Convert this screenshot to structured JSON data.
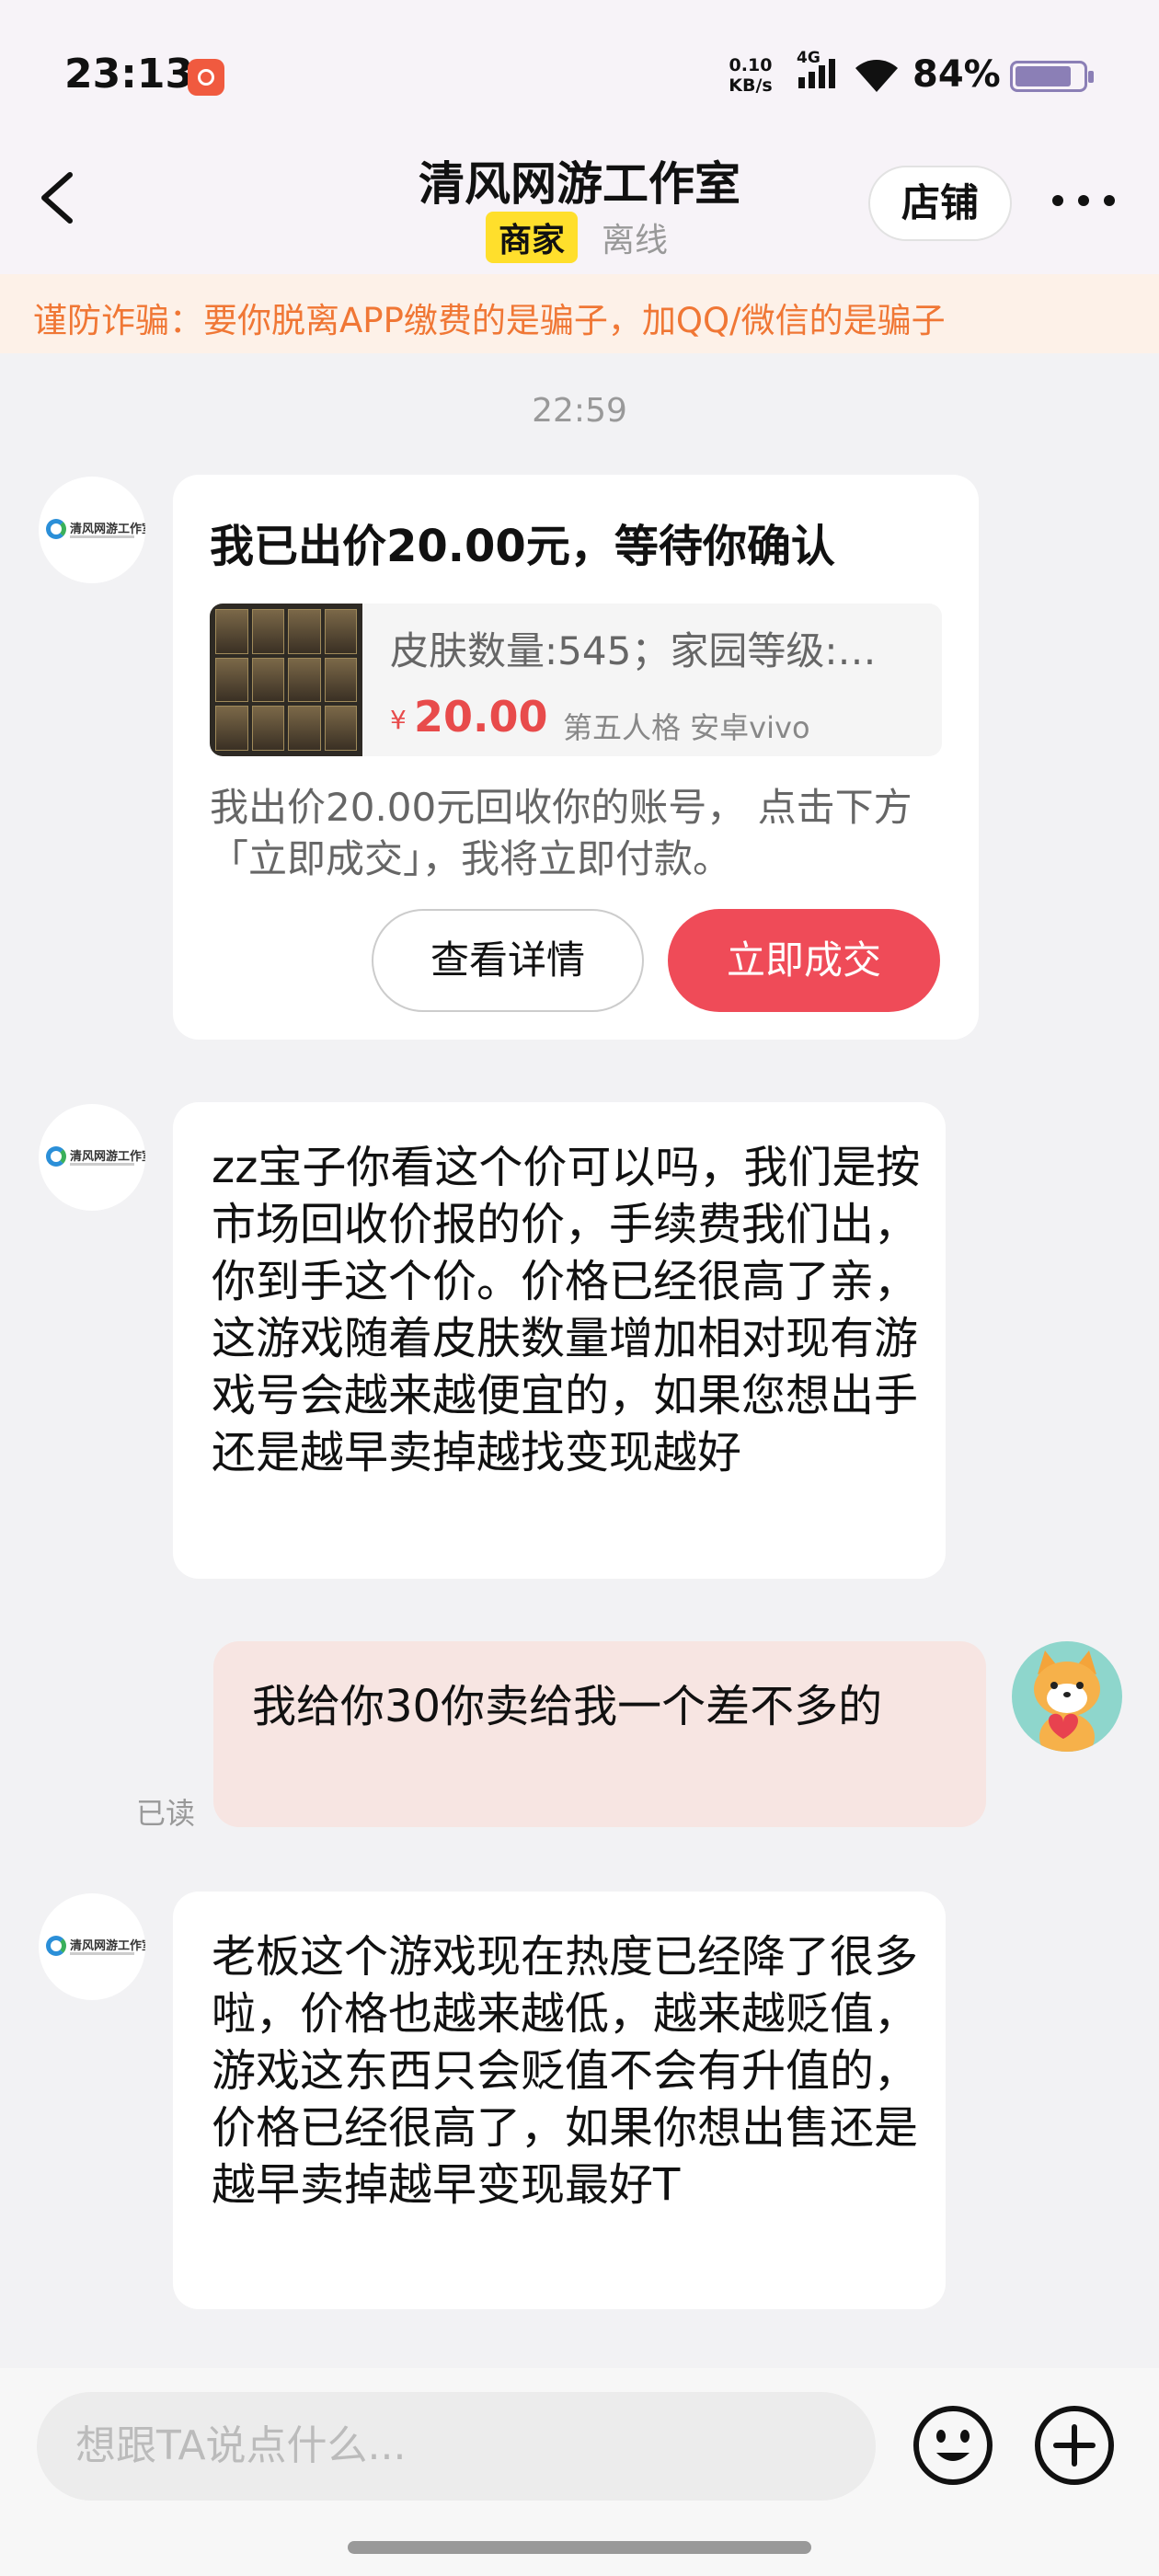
{
  "status_bar": {
    "time": "23:13",
    "net_speed_value": "0.10",
    "net_speed_unit": "KB/s",
    "network_type": "4G",
    "battery": "84%",
    "battery_level": 0.84
  },
  "header": {
    "title": "清风网游工作室",
    "badge": "商家",
    "status": "离线",
    "shop_button": "店铺"
  },
  "warning": "谨防诈骗：要你脱离APP缴费的是骗子，加QQ/微信的是骗子",
  "timestamp": "22:59",
  "offer_card": {
    "title": "我已出价20.00元，等待你确认",
    "product_desc": "皮肤数量:545；家园等级:…",
    "currency": "¥",
    "price": "20.00",
    "tags": "第五人格 安卓vivo",
    "note": "我出价20.00元回收你的账号， 点击下方「立即成交」，我将立即付款。",
    "detail_button": "查看详情",
    "deal_button": "立即成交"
  },
  "messages": [
    {
      "text": "zz宝子你看这个价可以吗，我们是按市场回收价报的价，手续费我们出，你到手这个价。价格已经很高了亲，这游戏随着皮肤数量增加相对现有游戏号会越来越便宜的，如果您想出手还是越早卖掉越找变现越好"
    },
    {
      "text": "我给你30你卖给我一个差不多的",
      "read": "已读"
    },
    {
      "text": "老板这个游戏现在热度已经降了很多啦，价格也越来越低，越来越贬值，游戏这东西只会贬值不会有升值的，价格已经很高了，如果你想出售还是越早卖掉越早变现最好T"
    }
  ],
  "input": {
    "placeholder": "想跟TA说点什么..."
  },
  "colors": {
    "accent_red": "#ef4b58",
    "warning_orange": "#f07735",
    "badge_yellow": "#ffdf2c"
  }
}
